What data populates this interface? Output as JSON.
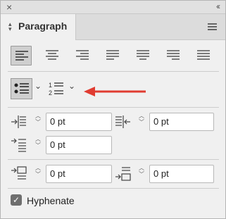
{
  "titlebar": {
    "close_glyph": "×",
    "collapse_glyph": "‹‹"
  },
  "tab": {
    "label": "Paragraph",
    "updown_glyph": "◇"
  },
  "alignment": {
    "buttons": [
      {
        "name": "align-left-icon",
        "active": true
      },
      {
        "name": "align-center-icon",
        "active": false
      },
      {
        "name": "align-right-icon",
        "active": false
      },
      {
        "name": "justify-last-left-icon",
        "active": false
      },
      {
        "name": "justify-last-center-icon",
        "active": false
      },
      {
        "name": "justify-last-right-icon",
        "active": false
      },
      {
        "name": "justify-all-icon",
        "active": false
      }
    ]
  },
  "lists": {
    "bulleted_icon": "bulleted-list-icon",
    "numbered_icon": "numbered-list-icon",
    "chevron": "⌄"
  },
  "annotation": {
    "arrow_color": "#e03c31"
  },
  "fields": {
    "left_indent": {
      "value": "0 pt"
    },
    "right_indent": {
      "value": "0 pt"
    },
    "first_line_indent": {
      "value": "0 pt"
    },
    "space_before": {
      "value": "0 pt"
    },
    "space_after": {
      "value": "0 pt"
    }
  },
  "hyphenate": {
    "label": "Hyphenate",
    "checked": true
  }
}
